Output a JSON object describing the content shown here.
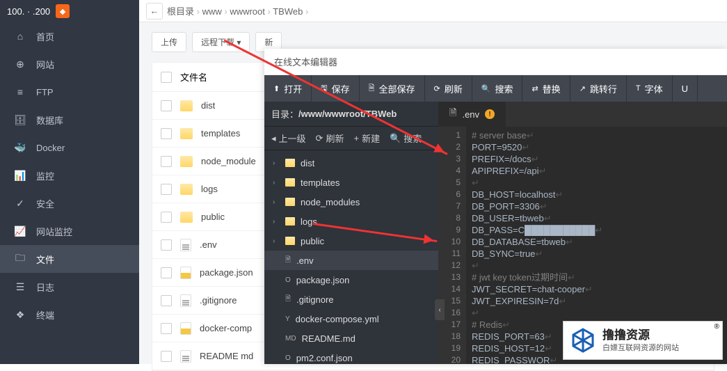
{
  "sidebar": {
    "ip_label": "100. · .200",
    "items": [
      {
        "icon": "home",
        "label": "首页"
      },
      {
        "icon": "globe",
        "label": "网站"
      },
      {
        "icon": "ftp",
        "label": "FTP"
      },
      {
        "icon": "db",
        "label": "数据库"
      },
      {
        "icon": "docker",
        "label": "Docker"
      },
      {
        "icon": "monitor",
        "label": "监控"
      },
      {
        "icon": "shield",
        "label": "安全"
      },
      {
        "icon": "chart",
        "label": "网站监控"
      },
      {
        "icon": "folder",
        "label": "文件",
        "active": true
      },
      {
        "icon": "log",
        "label": "日志"
      },
      {
        "icon": "terminal",
        "label": "终端"
      }
    ]
  },
  "breadcrumb": [
    "根目录",
    "www",
    "wwwroot",
    "TBWeb"
  ],
  "toolbar": {
    "upload": "上传",
    "remote": "远程下载 ▾",
    "new": "新"
  },
  "table": {
    "header": "文件名",
    "rows": [
      {
        "t": "folder",
        "name": "dist"
      },
      {
        "t": "folder",
        "name": "templates"
      },
      {
        "t": "folder",
        "name": "node_module"
      },
      {
        "t": "folder",
        "name": "logs"
      },
      {
        "t": "folder",
        "name": "public"
      },
      {
        "t": "file",
        "name": ".env"
      },
      {
        "t": "filey",
        "name": "package.json"
      },
      {
        "t": "file",
        "name": ".gitignore"
      },
      {
        "t": "filey",
        "name": "docker-comp"
      },
      {
        "t": "file",
        "name": "README md"
      }
    ]
  },
  "modal": {
    "title": "在线文本编辑器",
    "buttons": {
      "open": "打开",
      "save": "保存",
      "saveall": "全部保存",
      "refresh": "刷新",
      "search": "搜索",
      "replace": "替换",
      "goto": "跳转行",
      "font": "字体",
      "u": "U"
    },
    "path_label": "目录：",
    "path": "/www/wwwroot/TBWeb",
    "tree_actions": {
      "up": "上一级",
      "refresh": "刷新",
      "new": "新建",
      "search": "搜索"
    },
    "tree": [
      {
        "t": "folder",
        "name": "dist"
      },
      {
        "t": "folder",
        "name": "templates"
      },
      {
        "t": "folder",
        "name": "node_modules"
      },
      {
        "t": "folder",
        "name": "logs"
      },
      {
        "t": "folder",
        "name": "public"
      },
      {
        "t": "file",
        "name": ".env",
        "sel": true
      },
      {
        "t": "file",
        "name": "package.json",
        "icon": "O"
      },
      {
        "t": "file",
        "name": ".gitignore"
      },
      {
        "t": "file",
        "name": "docker-compose.yml",
        "icon": "Y"
      },
      {
        "t": "file",
        "name": "README.md",
        "icon": "MD"
      },
      {
        "t": "file",
        "name": "pm2.conf.json",
        "icon": "O"
      }
    ],
    "tab": {
      "name": ".env"
    },
    "code_lines": [
      "# server base",
      "PORT=9520",
      "PREFIX=/docs",
      "APIPREFIX=/api",
      "",
      "DB_HOST=localhost",
      "DB_PORT=3306",
      "DB_USER=tbweb",
      "DB_PASS=C███████████",
      "DB_DATABASE=tbweb",
      "DB_SYNC=true",
      "",
      "# jwt key token过期时间",
      "JWT_SECRET=chat-cooper",
      "JWT_EXPIRESIN=7d",
      "",
      "# Redis",
      "REDIS_PORT=63",
      "REDIS_HOST=12",
      "REDIS_PASSWOR"
    ]
  },
  "watermark": {
    "title": "撸撸资源",
    "sub": "白嫖互联网资源的网站",
    "r": "®"
  }
}
